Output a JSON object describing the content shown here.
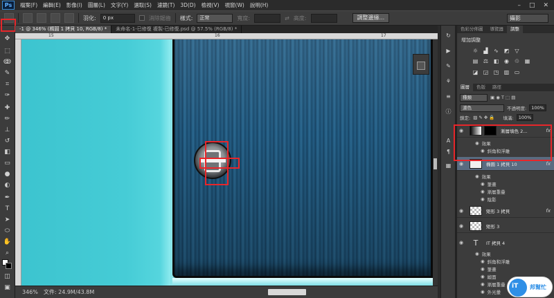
{
  "menubar": {
    "logo": "Ps",
    "items": [
      "檔案(F)",
      "編輯(E)",
      "影像(I)",
      "圖層(L)",
      "文字(Y)",
      "選取(S)",
      "濾鏡(T)",
      "3D(D)",
      "檢視(V)",
      "視窗(W)",
      "說明(H)"
    ],
    "window_controls": [
      "–",
      "□",
      "✕"
    ]
  },
  "options": {
    "feather_label": "羽化:",
    "feather_value": "0 px",
    "antialias_label": "消除鋸齒",
    "style_label": "樣式:",
    "style_value": "正常",
    "width_label": "寬度:",
    "height_label": "高度:",
    "refine_button": "調整邊緣...",
    "workspace_value": "攝影"
  },
  "tabs": [
    {
      "label": "-1 @ 346% (橢圓 1 拷貝 10, RGB/8) *",
      "active": true
    },
    {
      "label": "未命名-1-已修復 複製-已修復.psd @ 57.5% (RGB/8) *",
      "active": false
    }
  ],
  "ruler": {
    "marks": [
      "15",
      "16",
      "17"
    ]
  },
  "status": {
    "zoom": "346%",
    "file": "文件: 24.9M/43.8M"
  },
  "panel": {
    "top_tabs": [
      "色彩分佈圖",
      "導覽器",
      "調整"
    ],
    "adjust_title": "增加調整",
    "layer_tabs": [
      "圖層",
      "色版",
      "路徑"
    ],
    "kind_label": "種類",
    "blend_mode": "濾色",
    "opacity_label": "不透明度:",
    "opacity_value": "100%",
    "lock_label": "鎖定:",
    "fill_label": "填滿:",
    "fill_value": "100%",
    "layers": [
      {
        "name": "漸層填色 2...",
        "fx": "fx",
        "effects_label": "效果",
        "effects": [
          "斜角和浮雕"
        ]
      },
      {
        "name": "橢圓 1 拷貝 10",
        "fx": "fx",
        "effects_label": "效果",
        "effects": [
          "筆畫",
          "漸層重疊",
          "陰影"
        ]
      },
      {
        "name": "矩形 3 拷貝",
        "fx": "fx"
      },
      {
        "name": "矩形 3",
        "fx": ""
      },
      {
        "name": "IT 拷貝 4",
        "fx": "",
        "effects_label": "效果",
        "effects": [
          "斜角和浮雕",
          "筆畫",
          "緞面",
          "漸層重疊",
          "外光暈"
        ]
      }
    ]
  },
  "watermark": {
    "circle_text": "iT",
    "side_text": "邦幫忙"
  },
  "icons": {
    "move": "move-icon",
    "marquee": "rect-marquee-icon",
    "lasso": "lasso-icon",
    "brush": "brush-icon",
    "eye": "eye-icon"
  }
}
